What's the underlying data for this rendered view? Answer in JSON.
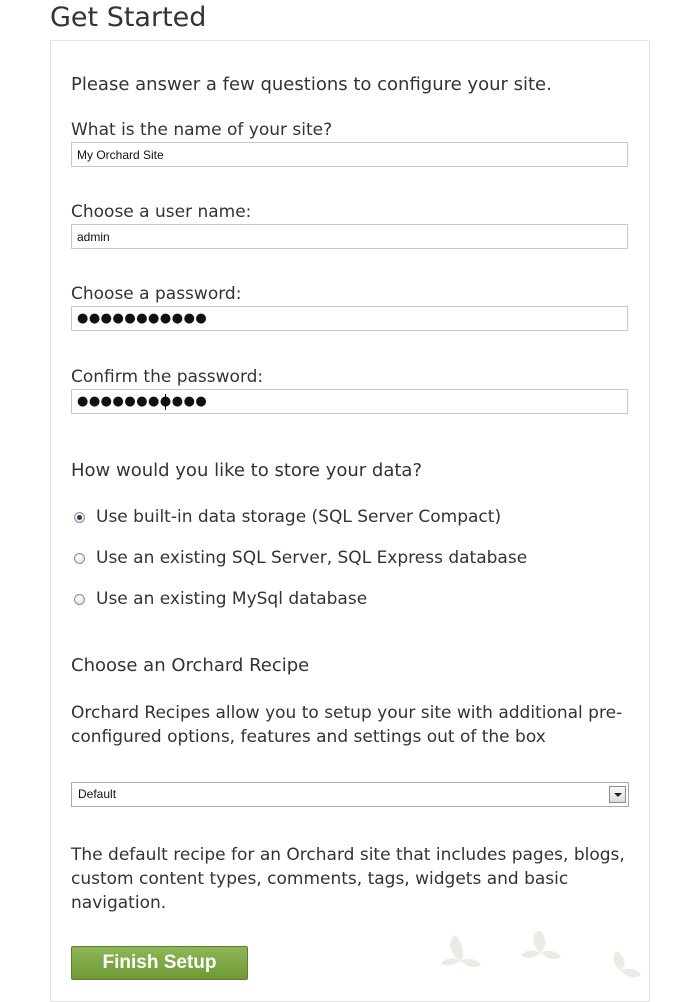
{
  "page": {
    "title": "Get Started"
  },
  "form": {
    "intro": "Please answer a few questions to configure your site.",
    "site_name": {
      "label": "What is the name of your site?",
      "value": "My Orchard Site"
    },
    "user_name": {
      "label": "Choose a user name:",
      "value": "admin"
    },
    "password": {
      "label": "Choose a password:",
      "masked": "●●●●●●●●●●●"
    },
    "confirm_password": {
      "label": "Confirm the password:",
      "masked": "●●●●●●●●●●●"
    },
    "storage": {
      "heading": "How would you like to store your data?",
      "options": [
        {
          "label": "Use built-in data storage (SQL Server Compact)",
          "selected": true
        },
        {
          "label": "Use an existing SQL Server, SQL Express database",
          "selected": false
        },
        {
          "label": "Use an existing MySql database",
          "selected": false
        }
      ]
    },
    "recipe": {
      "heading": "Choose an Orchard Recipe",
      "description": "Orchard Recipes allow you to setup your site with additional pre-configured options, features and settings out of the box",
      "selected": "Default",
      "selected_description": "The default recipe for an Orchard site that includes pages, blogs, custom content types, comments, tags, widgets and basic navigation."
    },
    "submit_label": "Finish Setup"
  },
  "colors": {
    "button_green": "#7aa843",
    "text": "#333333",
    "border": "#c9c9c9"
  },
  "icons": {
    "decoration": "leaves-icon",
    "dropdown": "chevron-down-icon"
  }
}
